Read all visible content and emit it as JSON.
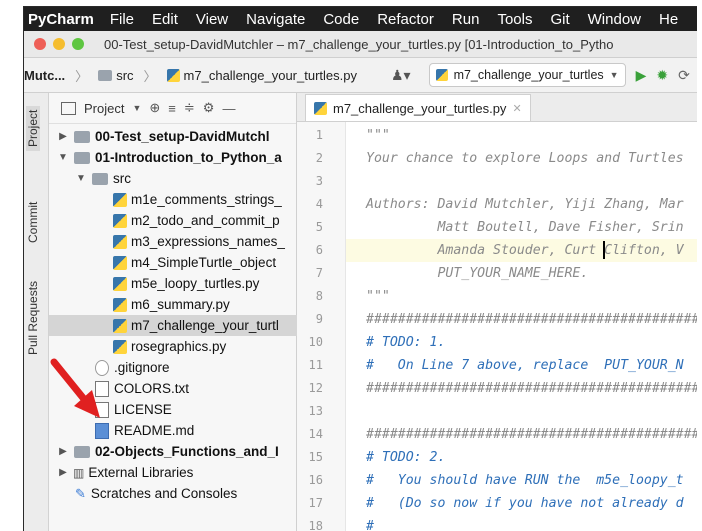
{
  "menubar": {
    "app": "PyCharm",
    "items": [
      "File",
      "Edit",
      "View",
      "Navigate",
      "Code",
      "Refactor",
      "Run",
      "Tools",
      "Git",
      "Window",
      "He"
    ]
  },
  "titlebar": {
    "title": "00-Test_setup-DavidMutchler – m7_challenge_your_turtles.py [01-Introduction_to_Pytho"
  },
  "navbar": {
    "crumb_root": "Mutc...",
    "crumb_src": "src",
    "crumb_file": "m7_challenge_your_turtles.py",
    "run_config": "m7_challenge_your_turtles"
  },
  "left_strip": {
    "project": "Project",
    "commit": "Commit",
    "pull_requests": "Pull Requests"
  },
  "project_panel": {
    "header": "Project",
    "items": [
      {
        "label": "00-Test_setup-DavidMutchl",
        "kind": "folder",
        "bold": true,
        "expanded": false
      },
      {
        "label": "01-Introduction_to_Python_a",
        "kind": "folder",
        "bold": true,
        "expanded": true
      },
      {
        "label": "src",
        "kind": "folder",
        "bold": false,
        "expanded": true
      },
      {
        "label": "m1e_comments_strings_",
        "kind": "py"
      },
      {
        "label": "m2_todo_and_commit_p",
        "kind": "py"
      },
      {
        "label": "m3_expressions_names_",
        "kind": "py"
      },
      {
        "label": "m4_SimpleTurtle_object",
        "kind": "py"
      },
      {
        "label": "m5e_loopy_turtles.py",
        "kind": "py"
      },
      {
        "label": "m6_summary.py",
        "kind": "py"
      },
      {
        "label": "m7_challenge_your_turtl",
        "kind": "py",
        "selected": true
      },
      {
        "label": "rosegraphics.py",
        "kind": "py"
      },
      {
        "label": ".gitignore",
        "kind": "txt"
      },
      {
        "label": "COLORS.txt",
        "kind": "txt"
      },
      {
        "label": "LICENSE",
        "kind": "txt"
      },
      {
        "label": "README.md",
        "kind": "md"
      },
      {
        "label": "02-Objects_Functions_and_I",
        "kind": "folder",
        "bold": true,
        "expanded": false
      },
      {
        "label": "External Libraries",
        "kind": "lib",
        "expanded": false
      },
      {
        "label": "Scratches and Consoles",
        "kind": "scratch"
      }
    ]
  },
  "editor": {
    "tab_label": "m7_challenge_your_turtles.py",
    "lines": [
      {
        "n": "1",
        "text": "\"\"\"",
        "style": "doc"
      },
      {
        "n": "2",
        "text": "Your chance to explore Loops and Turtles",
        "style": "doc"
      },
      {
        "n": "3",
        "text": "",
        "style": "doc"
      },
      {
        "n": "4",
        "text": "Authors: David Mutchler, Yiji Zhang, Mar",
        "style": "doc"
      },
      {
        "n": "5",
        "text": "         Matt Boutell, Dave Fisher, Srin",
        "style": "doc"
      },
      {
        "n": "6",
        "text": "         Amanda Stouder, Curt Clifton, V",
        "style": "doc",
        "highlight": true
      },
      {
        "n": "7",
        "text": "         PUT_YOUR_NAME_HERE.",
        "style": "doc"
      },
      {
        "n": "8",
        "text": "\"\"\"",
        "style": "doc"
      },
      {
        "n": "9",
        "text": "###################################################",
        "style": "doc"
      },
      {
        "n": "10",
        "text": "# TODO: 1.",
        "style": "todo"
      },
      {
        "n": "11",
        "text": "#   On Line 7 above, replace  PUT_YOUR_N",
        "style": "todo"
      },
      {
        "n": "12",
        "text": "###################################################",
        "style": "doc"
      },
      {
        "n": "13",
        "text": "",
        "style": "doc"
      },
      {
        "n": "14",
        "text": "###################################################",
        "style": "doc"
      },
      {
        "n": "15",
        "text": "# TODO: 2.",
        "style": "todo"
      },
      {
        "n": "16",
        "text": "#   You should have RUN the  m5e_loopy_t",
        "style": "todo"
      },
      {
        "n": "17",
        "text": "#   (Do so now if you have not already d",
        "style": "todo"
      },
      {
        "n": "18",
        "text": "#  _",
        "style": "todo"
      }
    ]
  },
  "colors": {
    "menubar_bg": "#1f1f1f",
    "selection": "#d5d5d5",
    "todo_blue": "#2e6fb8",
    "doc_gray": "#8a8a8a",
    "annotation_arrow": "#e02020"
  }
}
